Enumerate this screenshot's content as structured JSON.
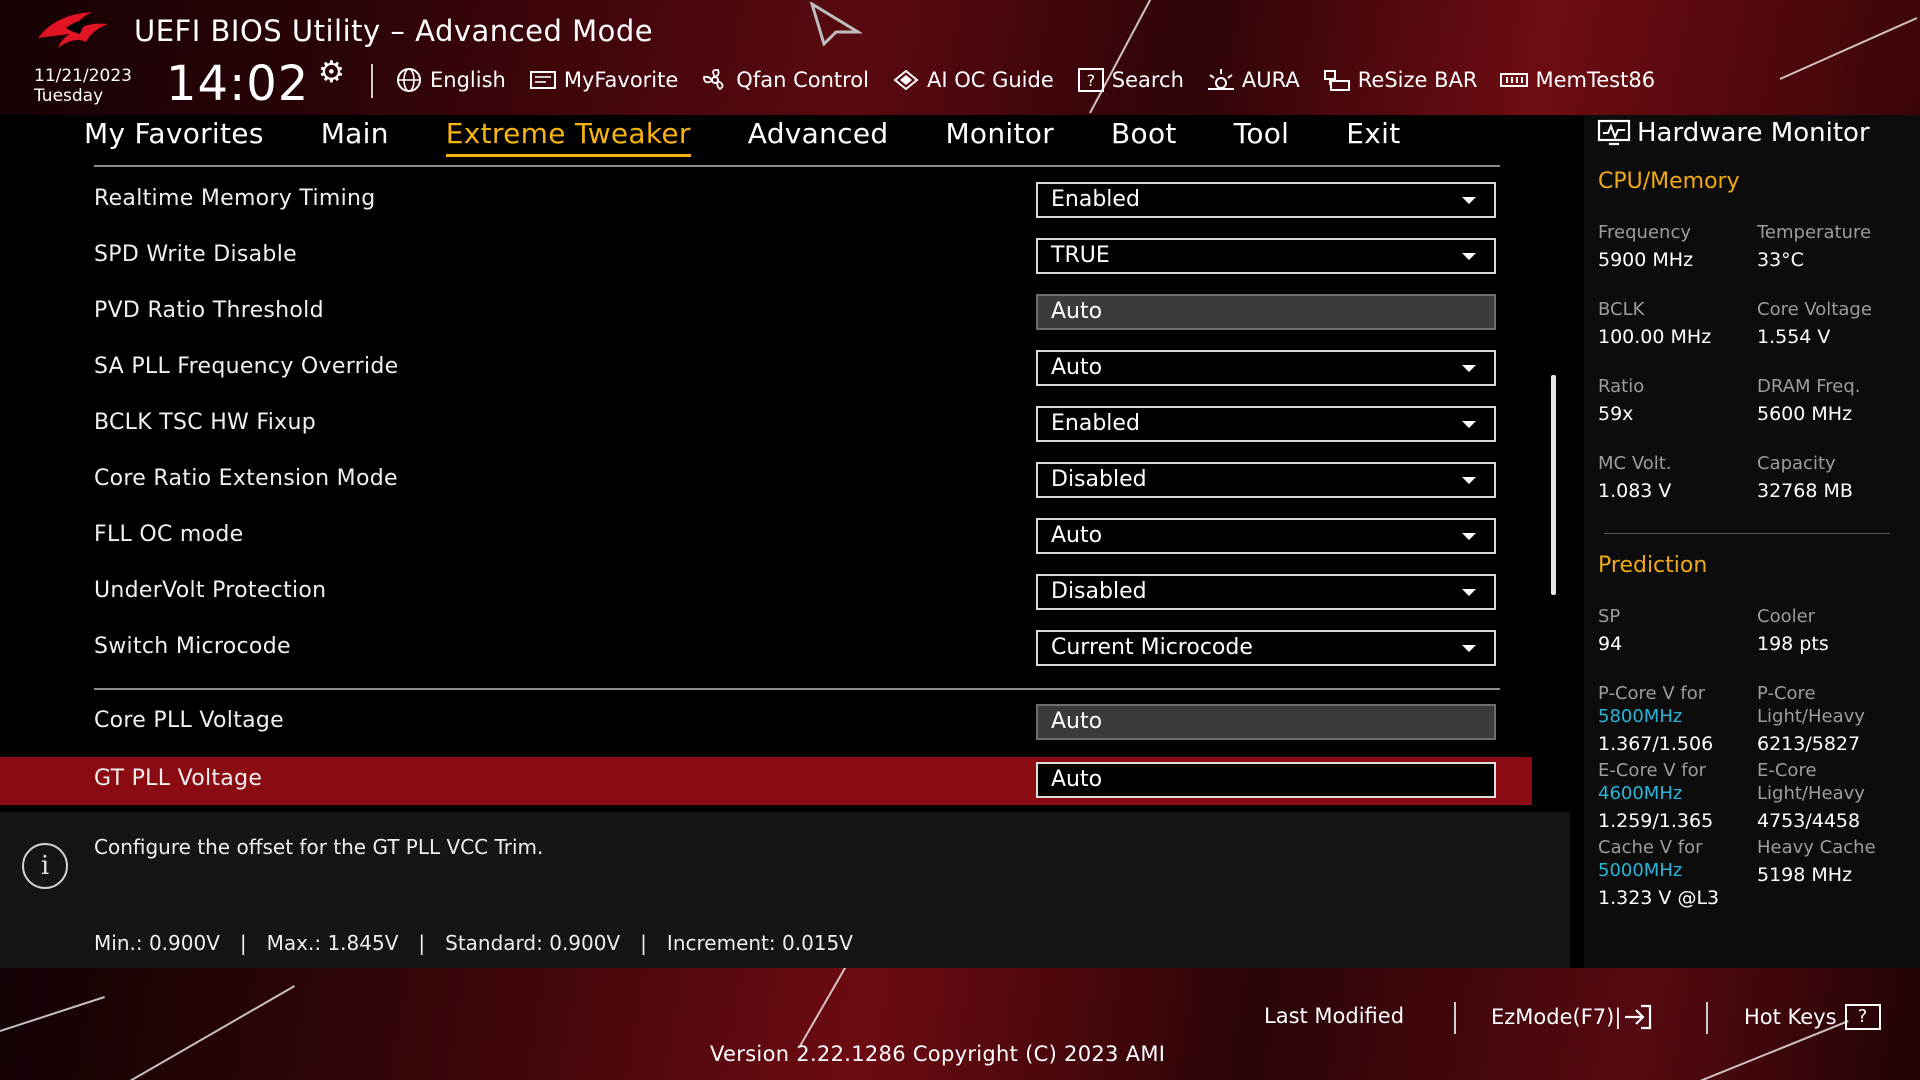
{
  "header": {
    "title": "UEFI BIOS Utility – Advanced Mode",
    "date": "11/21/2023",
    "day": "Tuesday",
    "time": "14:02"
  },
  "toolbar": [
    {
      "label": "English",
      "icon": "globe-icon"
    },
    {
      "label": "MyFavorite",
      "icon": "favorite-icon"
    },
    {
      "label": "Qfan Control",
      "icon": "fan-icon"
    },
    {
      "label": "AI OC Guide",
      "icon": "ai-oc-icon"
    },
    {
      "label": "Search",
      "icon": "search-icon"
    },
    {
      "label": "AURA",
      "icon": "aura-icon"
    },
    {
      "label": "ReSize BAR",
      "icon": "resize-bar-icon"
    },
    {
      "label": "MemTest86",
      "icon": "memtest-icon"
    }
  ],
  "menu": {
    "items": [
      "My Favorites",
      "Main",
      "Extreme Tweaker",
      "Advanced",
      "Monitor",
      "Boot",
      "Tool",
      "Exit"
    ],
    "active": "Extreme Tweaker"
  },
  "settings": [
    {
      "label": "Realtime Memory Timing",
      "value": "Enabled",
      "type": "dropdown"
    },
    {
      "label": "SPD Write Disable",
      "value": "TRUE",
      "type": "dropdown"
    },
    {
      "label": "PVD Ratio Threshold",
      "value": "Auto",
      "type": "field"
    },
    {
      "label": "SA PLL Frequency Override",
      "value": "Auto",
      "type": "dropdown"
    },
    {
      "label": "BCLK TSC HW Fixup",
      "value": "Enabled",
      "type": "dropdown"
    },
    {
      "label": "Core Ratio Extension Mode",
      "value": "Disabled",
      "type": "dropdown"
    },
    {
      "label": "FLL OC mode",
      "value": "Auto",
      "type": "dropdown"
    },
    {
      "label": "UnderVolt Protection",
      "value": "Disabled",
      "type": "dropdown"
    },
    {
      "label": "Switch Microcode",
      "value": "Current Microcode",
      "type": "dropdown"
    },
    {
      "label": "Core PLL Voltage",
      "value": "Auto",
      "type": "field"
    },
    {
      "label": "GT PLL Voltage",
      "value": "Auto",
      "type": "field",
      "selected": true
    }
  ],
  "help": {
    "text": "Configure the offset for the GT PLL VCC Trim.",
    "min": "Min.: 0.900V",
    "max": "Max.: 1.845V",
    "standard": "Standard: 0.900V",
    "increment": "Increment: 0.015V",
    "separator": "|"
  },
  "hardware_monitor": {
    "title": "Hardware Monitor",
    "cpu_memory": {
      "heading": "CPU/Memory",
      "frequency_label": "Frequency",
      "frequency": "5900 MHz",
      "temperature_label": "Temperature",
      "temperature": "33°C",
      "bclk_label": "BCLK",
      "bclk": "100.00 MHz",
      "core_voltage_label": "Core Voltage",
      "core_voltage": "1.554 V",
      "ratio_label": "Ratio",
      "ratio": "59x",
      "dram_freq_label": "DRAM Freq.",
      "dram_freq": "5600 MHz",
      "mc_volt_label": "MC Volt.",
      "mc_volt": "1.083 V",
      "capacity_label": "Capacity",
      "capacity": "32768 MB"
    },
    "prediction": {
      "heading": "Prediction",
      "sp_label": "SP",
      "sp": "94",
      "cooler_label": "Cooler",
      "cooler": "198 pts",
      "pcore_v_label": "P-Core V for",
      "pcore_v_freq": "5800MHz",
      "pcore_v": "1.367/1.506",
      "pcore_lh_label1": "P-Core",
      "pcore_lh_label2": "Light/Heavy",
      "pcore_lh": "6213/5827",
      "ecore_v_label": "E-Core V for",
      "ecore_v_freq": "4600MHz",
      "ecore_v": "1.259/1.365",
      "ecore_lh_label1": "E-Core",
      "ecore_lh_label2": "Light/Heavy",
      "ecore_lh": "4753/4458",
      "cache_v_label": "Cache V for",
      "cache_v_freq": "5000MHz",
      "cache_v": "1.323 V @L3",
      "heavy_cache_label": "Heavy Cache",
      "heavy_cache": "5198 MHz"
    }
  },
  "footer": {
    "last_modified": "Last Modified",
    "ezmode": "EzMode(F7)|",
    "hotkeys": "Hot Keys",
    "hotkeys_icon": "?",
    "version": "Version 2.22.1286 Copyright (C) 2023 AMI"
  },
  "colors": {
    "accent": "#f7b30f",
    "selected_row": "#8b0b13",
    "monitor_heading": "#f0a918",
    "frequency_cyan": "#2ab4d8"
  }
}
